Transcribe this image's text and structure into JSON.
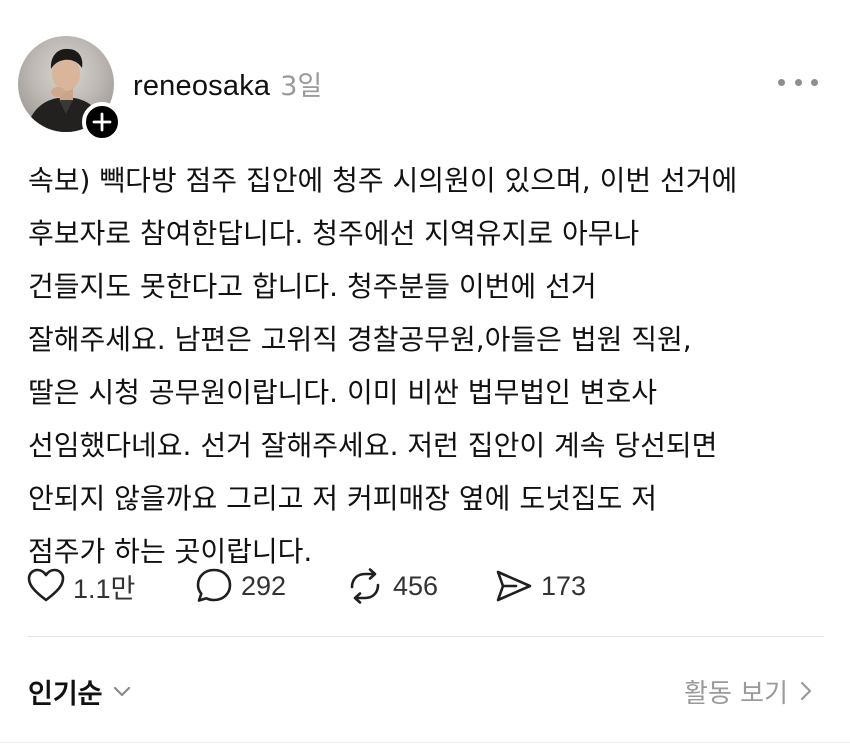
{
  "post": {
    "author": {
      "username": "reneosaka",
      "time": "3일"
    },
    "body_lines": [
      "속보) 빽다방 점주 집안에 청주 시의원이 있으며, 이번 선거에",
      "후보자로 참여한답니다. 청주에선 지역유지로 아무나",
      "건들지도 못한다고 합니다. 청주분들 이번에 선거",
      "잘해주세요. 남편은 고위직 경찰공무원,아들은 법원 직원,",
      "딸은 시청 공무원이랍니다. 이미 비싼 법무법인 변호사",
      "선임했다네요. 선거 잘해주세요. 저런 집안이 계속 당선되면",
      "안되지 않을까요 그리고 저 커피매장 옆에 도넛집도 저",
      "점주가 하는 곳이랍니다."
    ],
    "actions": {
      "likes": "1.1만",
      "replies": "292",
      "reposts": "456",
      "shares": "173"
    }
  },
  "footer": {
    "sort_label": "인기순",
    "activity_label": "활동 보기"
  },
  "icons": {
    "follow": "plus-icon",
    "more": "more-horizontal-icon",
    "like": "heart-icon",
    "reply": "comment-bubble-icon",
    "repost": "repost-icon",
    "share": "send-icon",
    "sort": "chevron-down-icon",
    "activity": "chevron-right-icon"
  },
  "colors": {
    "text": "#111111",
    "muted": "#9a9a9a",
    "divider": "#e3e3e3",
    "badge": "#000000"
  }
}
